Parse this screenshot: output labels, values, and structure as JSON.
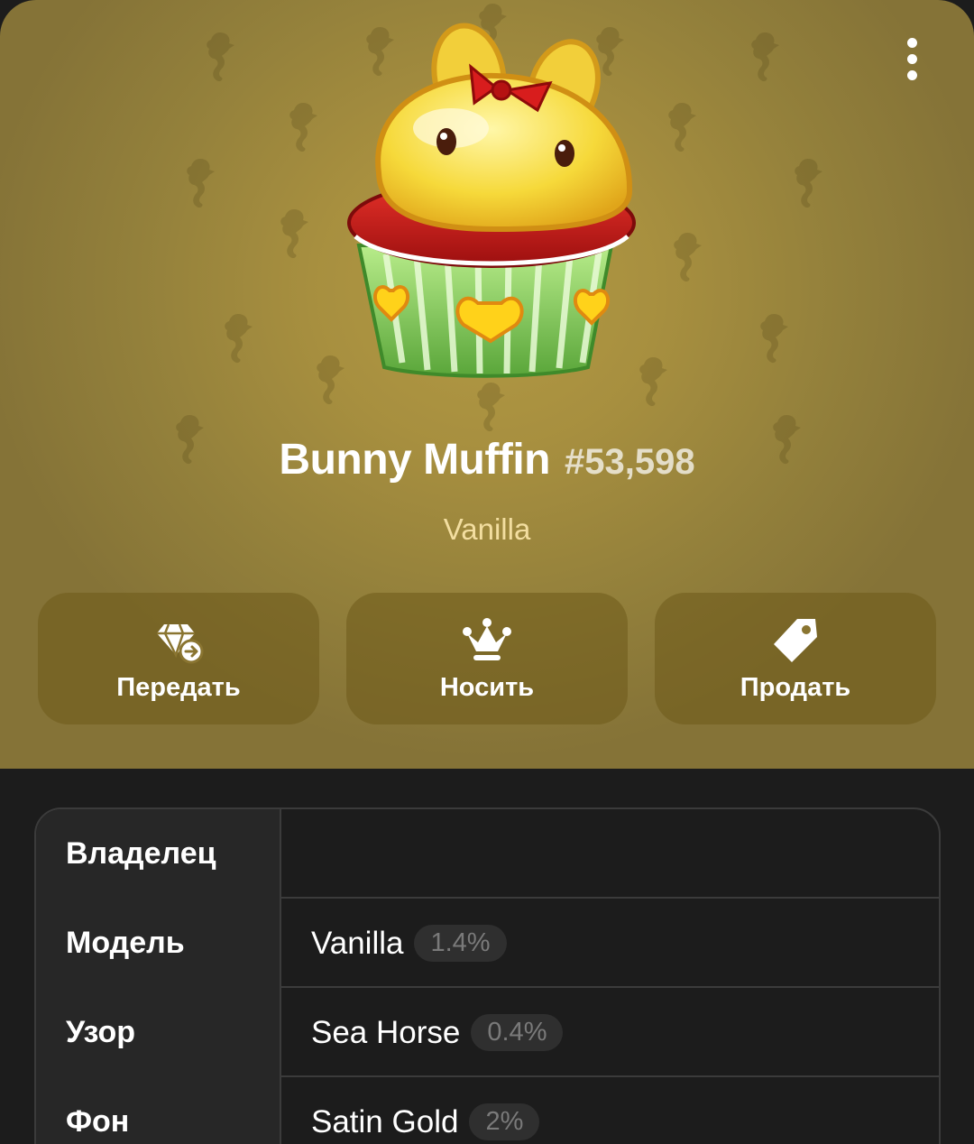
{
  "gift": {
    "name": "Bunny Muffin",
    "number": "#53,598",
    "model_subtitle": "Vanilla"
  },
  "header": {
    "background_color": "#a38b3e",
    "menu_icon": "more-vertical-icon"
  },
  "actions": [
    {
      "label": "Передать",
      "icon": "diamond-transfer-icon"
    },
    {
      "label": "Носить",
      "icon": "crown-icon"
    },
    {
      "label": "Продать",
      "icon": "price-tag-icon"
    }
  ],
  "details": {
    "owner": {
      "label": "Владелец",
      "value": ""
    },
    "model": {
      "label": "Модель",
      "value": "Vanilla",
      "rarity": "1.4%"
    },
    "pattern": {
      "label": "Узор",
      "value": "Sea Horse",
      "rarity": "0.4%"
    },
    "backdrop": {
      "label": "Фон",
      "value": "Satin Gold",
      "rarity": "2%"
    }
  }
}
